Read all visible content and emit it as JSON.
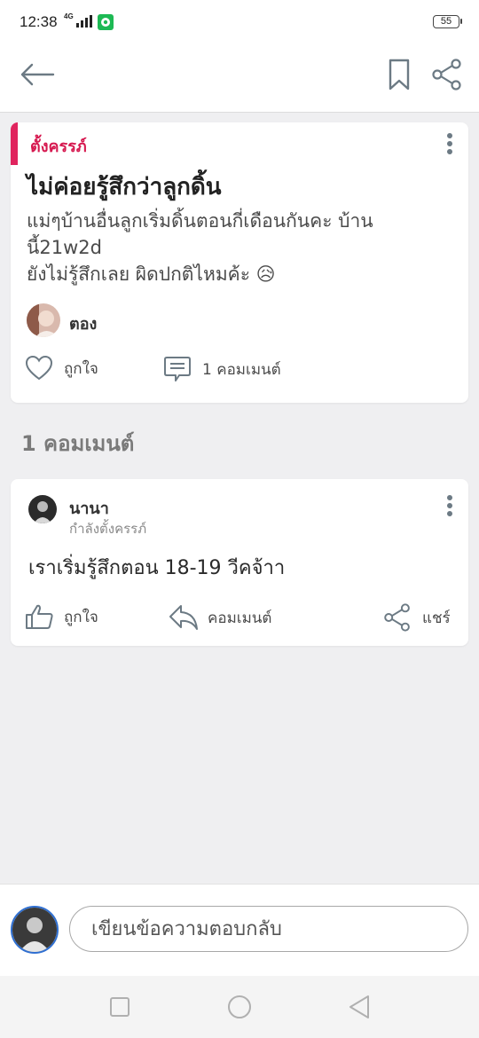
{
  "status_bar": {
    "time": "12:38",
    "network": "4G",
    "battery": "55"
  },
  "app_bar": {
    "back_icon": "arrow-left-icon",
    "bookmark_icon": "bookmark-icon",
    "share_icon": "share-icon"
  },
  "post": {
    "tag": "ตั้งครรภ์",
    "title": "ไม่ค่อยรู้สึกว่าลูกดิ้น",
    "body_lines": [
      "แม่ๆบ้านอื่นลูกเริ่มดิ้นตอนกี่เดือนกันคะ บ้าน",
      "นี้21w2d",
      "ยังไม่รู้สึกเลย ผิดปกติไหมค้ะ 😥"
    ],
    "author": "ตอง",
    "like_label": "ถูกใจ",
    "comment_label": "1 คอมเมนต์"
  },
  "comments_section": {
    "heading": "1 คอมเมนต์"
  },
  "comment": {
    "author": "นานา",
    "subtitle": "กำลังตั้งครรภ์",
    "text": "เราเริ่มรู้สึกตอน 18-19 วีคจ้าา",
    "like_label": "ถูกใจ",
    "comment_label": "คอมเมนต์",
    "share_label": "แชร์"
  },
  "reply": {
    "placeholder": "เขียนข้อความตอบกลับ"
  },
  "colors": {
    "accent": "#e0245e",
    "icon_gray": "#6c7a84",
    "background": "#efeff1"
  }
}
